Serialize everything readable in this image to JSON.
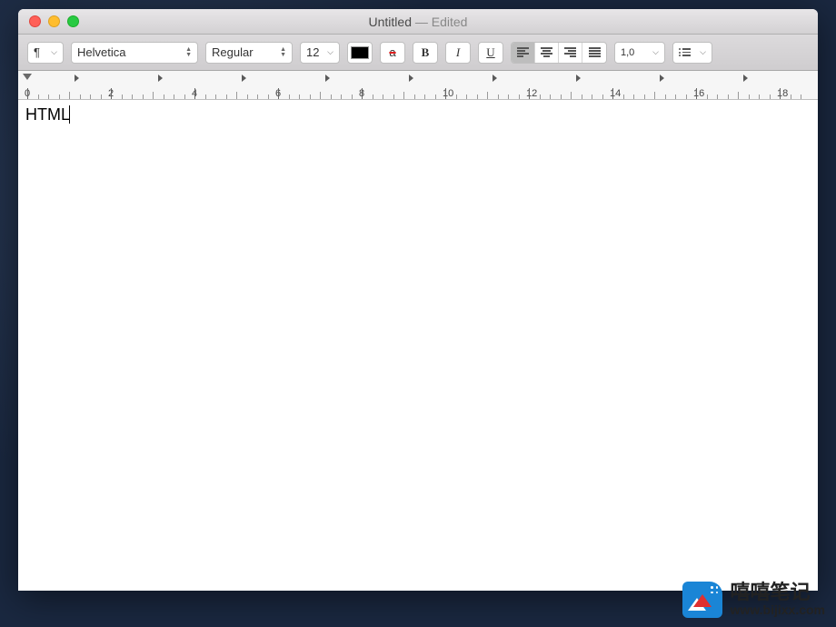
{
  "window": {
    "title": "Untitled",
    "status": "Edited"
  },
  "toolbar": {
    "paragraph_symbol": "¶",
    "font_family": "Helvetica",
    "font_weight": "Regular",
    "font_size": "12",
    "text_color": "#000000",
    "highlight_glyph": "a",
    "bold_label": "B",
    "italic_label": "I",
    "underline_label": "U",
    "line_spacing": "1,0",
    "active_alignment": "left"
  },
  "ruler": {
    "labels": [
      "0",
      "2",
      "4",
      "6",
      "8",
      "10",
      "12",
      "14",
      "16",
      "18"
    ]
  },
  "document": {
    "content": "HTML"
  },
  "watermark": {
    "name_cn": "嘻嘻笔记",
    "url": "www.bijixx.com"
  }
}
